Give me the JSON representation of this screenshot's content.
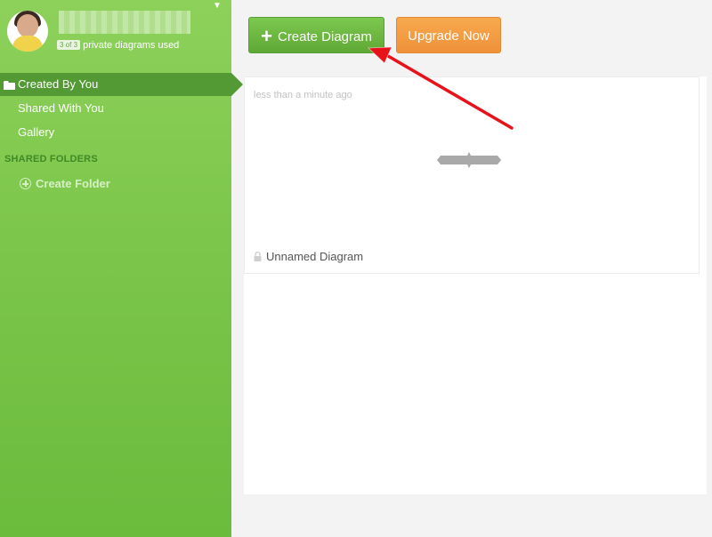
{
  "profile": {
    "usage_badge": "3 of 3",
    "usage_text": "private diagrams used",
    "menu_caret": "▼"
  },
  "nav": {
    "items": [
      {
        "label": "Created By You",
        "icon": "folder-icon",
        "active": true
      },
      {
        "label": "Shared With You"
      },
      {
        "label": "Gallery"
      }
    ],
    "shared_folders_title": "SHARED FOLDERS",
    "create_folder_label": "Create Folder"
  },
  "toolbar": {
    "create_label": "Create Diagram",
    "upgrade_label": "Upgrade Now"
  },
  "diagrams": [
    {
      "modified": "less than a minute ago",
      "name": "Unnamed Diagram",
      "private": true
    }
  ],
  "colors": {
    "sidebar": "#7cc64b",
    "active_nav": "#539a35",
    "create_button": "#6ab540",
    "upgrade_button": "#f39c3f",
    "annotation_arrow": "#e8131a"
  }
}
